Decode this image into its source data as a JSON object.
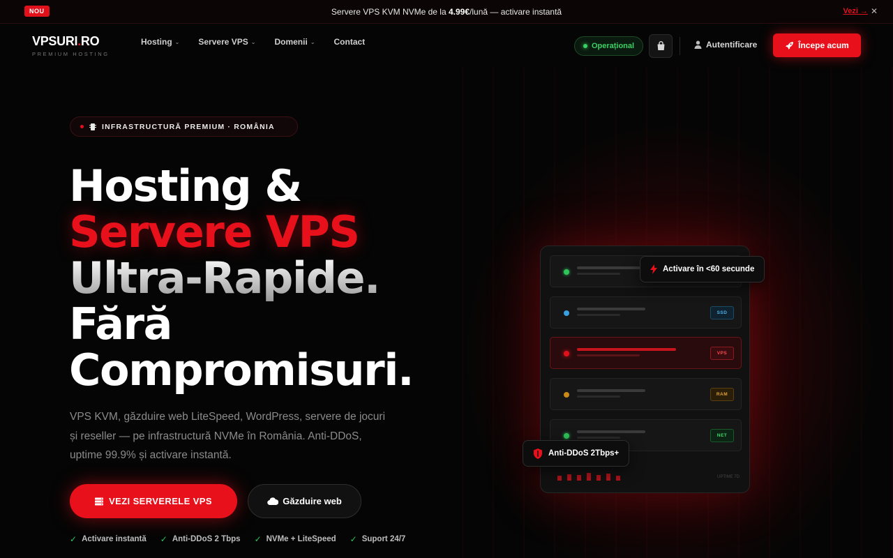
{
  "announce": {
    "badge": "NOU",
    "text_before": "Servere VPS KVM NVMe de la ",
    "price": "4.99€",
    "text_after": "/lună — activare instantă",
    "link": "Vezi →",
    "close": "✕"
  },
  "nav": {
    "logo_main": "VPSURI",
    "logo_dot": ".",
    "logo_tld": "RO",
    "logo_sub": "PREMIUM HOSTING",
    "menu": [
      {
        "label": "Hosting",
        "has_dropdown": true
      },
      {
        "label": "Servere VPS",
        "has_dropdown": true
      },
      {
        "label": "Domenii",
        "has_dropdown": true
      },
      {
        "label": "Contact",
        "has_dropdown": false
      }
    ],
    "status": "Operațional",
    "login": "Autentificare",
    "cta": "Începe acum"
  },
  "hero": {
    "pill": "INFRASTRUCTURĂ PREMIUM · ROMÂNIA",
    "line1": "Hosting &",
    "line2": "Servere VPS",
    "line3": "Ultra-Rapide.",
    "line4": "Fără",
    "line5": "Compromisuri.",
    "lead": "VPS KVM, găzduire web LiteSpeed, WordPress, servere de jocuri și reseller — pe infrastructură NVMe în România. Anti-DDoS, uptime 99.9% și activare instantă.",
    "btn_primary": "VEZI SERVERELE VPS",
    "btn_secondary": "Găzduire web",
    "features": [
      "Activare instantă",
      "Anti-DDoS 2 Tbps",
      "NVMe + LiteSpeed",
      "Suport 24/7"
    ]
  },
  "visual": {
    "float_top": "Activare în <60 secunde",
    "float_bottom": "Anti-DDoS 2Tbps+",
    "units": [
      {
        "tag": "",
        "led": "#2fc55a"
      },
      {
        "tag": "SSD",
        "led": "#3aa0e0"
      },
      {
        "tag": "VPS",
        "led": "#e0111b"
      },
      {
        "tag": "RAM",
        "led": "#c98a1a"
      },
      {
        "tag": "NET",
        "led": "#2fc55a"
      }
    ],
    "footer_label": "UPTIME 7D"
  },
  "colors": {
    "accent": "#e8101a",
    "success": "#2fc55a",
    "background": "#050505"
  }
}
